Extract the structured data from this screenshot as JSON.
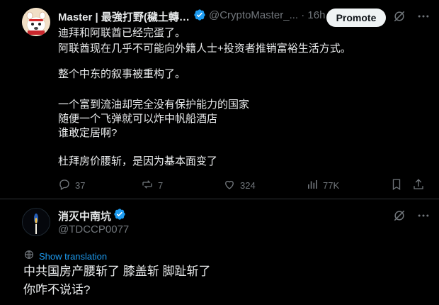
{
  "tweet": {
    "author_name": "Master | 最強打野(穢土轉…",
    "handle_time": "@CryptoMaster_... · 16h",
    "promote_label": "Promote",
    "body": [
      "迪拜和阿联酋已经完蛋了。",
      "阿联酋现在几乎不可能向外籍人士+投资者推销富裕生活方式。",
      "整个中东的叙事被重构了。",
      "一个富到流油却完全没有保护能力的国家",
      "随便一个飞弹就可以炸中帆船酒店",
      "谁敢定居啊?",
      "杜拜房价腰斩，是因为基本面变了"
    ],
    "actions": {
      "replies": "37",
      "reposts": "7",
      "likes": "324",
      "views": "77K"
    }
  },
  "reply": {
    "author_name": "消灭中南坑",
    "handle": "@TDCCP0077",
    "show_translation": "Show translation",
    "body": [
      "中共国房产腰斩了 膝盖斩 脚趾斩了",
      "你咋不说话?"
    ]
  },
  "colors": {
    "background": "#000000",
    "text": "#e7e9ea",
    "muted": "#71767b",
    "link": "#1d9bf0",
    "verified": "#1d9bf0"
  },
  "icons": [
    "verified-badge-icon",
    "grok-icon",
    "more-icon",
    "reply-icon",
    "repost-icon",
    "like-icon",
    "views-icon",
    "bookmark-icon",
    "share-icon",
    "translate-icon"
  ]
}
